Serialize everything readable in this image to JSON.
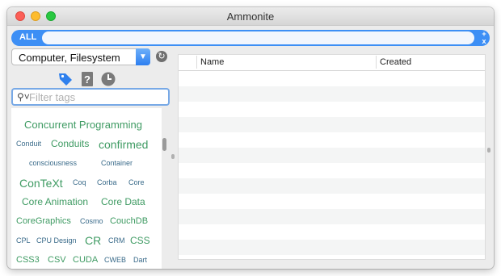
{
  "window": {
    "title": "Ammonite"
  },
  "search": {
    "all_label": "ALL",
    "value": "",
    "clear_plus": "+",
    "clear_x": "x"
  },
  "source": {
    "selected": "Computer, Filesystem"
  },
  "tag_filter": {
    "placeholder": "Filter tags"
  },
  "tags": [
    "Concurrent Programming",
    "Conduit",
    "Conduits",
    "confirmed",
    "consciousness",
    "Container",
    "ConTeXt",
    "Coq",
    "Corba",
    "Core",
    "Core Animation",
    "Core Data",
    "CoreGraphics",
    "Cosmo",
    "CouchDB",
    "CPL",
    "CPU Design",
    "CR",
    "CRM",
    "CSS",
    "CSS3",
    "CSV",
    "CUDA",
    "CWEB",
    "Dart"
  ],
  "table": {
    "columns": [
      "Name",
      "Created"
    ]
  },
  "icons": {
    "tag": "tag-icon",
    "help": "help-icon",
    "history": "clock-icon",
    "refresh": "refresh-icon",
    "search": "search-icon"
  },
  "colors": {
    "accent": "#3d8ff5",
    "tag_green": "#3f9b63",
    "tag_blue": "#3a6b8a"
  }
}
